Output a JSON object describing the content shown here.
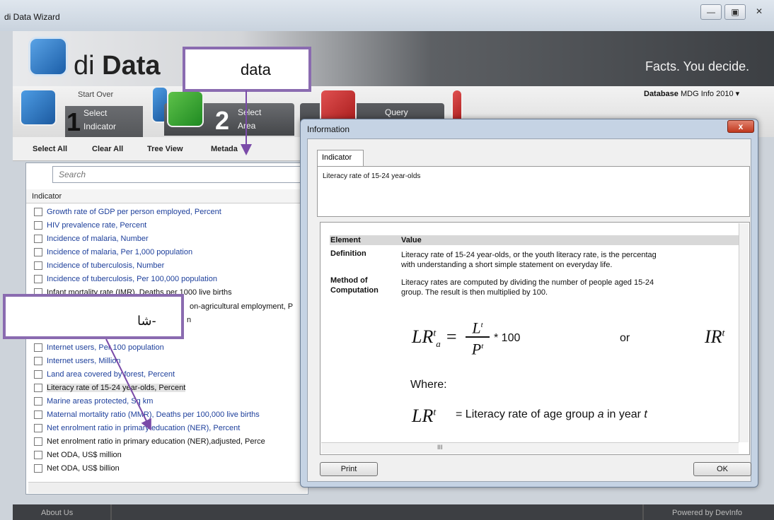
{
  "window": {
    "title": "di Data Wizard",
    "min": "—",
    "max": "▣",
    "close": "✕"
  },
  "header": {
    "brand_prefix": "di",
    "brand_main": "Data",
    "tagline": "Facts. You decide."
  },
  "steps": [
    {
      "num": "1",
      "label_line1": "Select",
      "label_line2": "Indicator"
    },
    {
      "num": "2",
      "label_line1": "Select",
      "label_line2": "Area"
    },
    {
      "num": "3",
      "label_line1": "Query",
      "label_line2": ""
    }
  ],
  "start_over": "Start Over",
  "database": {
    "label": "Database",
    "value": "MDG Info 2010"
  },
  "toolbar": {
    "select_all": "Select All",
    "clear_all": "Clear All",
    "tree_view": "Tree View",
    "metadata": "Metada"
  },
  "search": {
    "placeholder": "Search"
  },
  "list": {
    "header": "Indicator",
    "items": [
      "Growth rate of GDP per person employed, Percent",
      "HIV prevalence rate, Percent",
      "Incidence of malaria, Number",
      "Incidence of malaria, Per 1,000 population",
      "Incidence of tuberculosis, Number",
      "Incidence of tuberculosis, Per 100,000 population",
      "Infant mortality rate (IMR), Deaths per 1000 live births",
      "on-agricultural employment, P",
      "n",
      "",
      "Internet users, Per 100 population",
      "Internet users, Million",
      "Land area covered by forest, Percent",
      "Literacy rate of 15-24 year-olds, Percent",
      "Marine areas protected, Sq km",
      "Maternal mortality ratio (MMR), Deaths per 100,000 live births",
      "Net enrolment ratio in primary education (NER), Percent",
      "Net enrolment ratio in primary education (NER),adjusted, Perce",
      "Net ODA, US$ million",
      "Net ODA, US$ billion"
    ]
  },
  "footer": {
    "about": "About Us",
    "powered": "Powered by DevInfo"
  },
  "dialog": {
    "title": "Information",
    "close": "x",
    "tab": "Indicator",
    "indicator_name": "Literacy rate of 15-24 year-olds",
    "table_header": {
      "element": "Element",
      "value": "Value"
    },
    "definition_label": "Definition",
    "definition_text_1": "Literacy rate of 15-24 year-olds, or the youth literacy rate, is the percentag",
    "definition_text_2": "with understanding a short simple statement on everyday life.",
    "method_label_1": "Method of",
    "method_label_2": "Computation",
    "method_text_1": "Literacy rates are computed by dividing the number of people aged 15-24",
    "method_text_2": "group. The result is then multiplied by 100.",
    "formula_left": "LR",
    "formula_times": "* 100",
    "formula_or": "or",
    "formula_right": "IR",
    "where": "Where:",
    "where_def": "= Literacy rate of age group",
    "where_in": "in year",
    "scroll_mid": "III",
    "print_button": "Print",
    "ok_button": "OK"
  },
  "annotations": {
    "top": "data",
    "middle": "شا-"
  }
}
